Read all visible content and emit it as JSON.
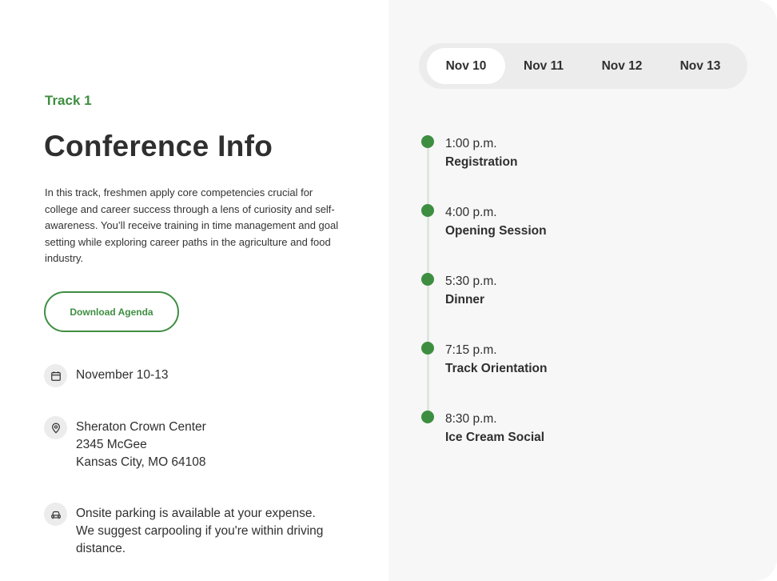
{
  "info": {
    "track_label": "Track 1",
    "title": "Conference Info",
    "description": "In this track, freshmen apply core competencies crucial for college and career success through a lens of curiosity and self-awareness. You’ll receive training in time management and goal setting while exploring career paths in the agriculture and food industry.",
    "download_label": "Download Agenda",
    "dates": "November 10-13",
    "venue": {
      "name": "Sheraton Crown Center",
      "street": "2345 McGee",
      "city": "Kansas City, MO 64108"
    },
    "parking": {
      "line1": "Onsite parking is available at your expense.",
      "line2": "We suggest carpooling if you're within driving",
      "line3": "distance."
    },
    "icons": {
      "date": "calendar-icon",
      "venue": "location-pin-icon",
      "parking": "car-icon"
    }
  },
  "schedule": {
    "tabs": [
      {
        "label": "Nov 10",
        "active": true
      },
      {
        "label": "Nov 11",
        "active": false
      },
      {
        "label": "Nov 12",
        "active": false
      },
      {
        "label": "Nov 13",
        "active": false
      }
    ],
    "events": [
      {
        "time": "1:00 p.m.",
        "name": "Registration"
      },
      {
        "time": "4:00 p.m.",
        "name": "Opening Session"
      },
      {
        "time": "5:30 p.m.",
        "name": "Dinner"
      },
      {
        "time": "7:15 p.m.",
        "name": "Track Orientation"
      },
      {
        "time": "8:30 p.m.",
        "name": "Ice Cream Social"
      }
    ]
  },
  "colors": {
    "accent": "#3e8e41",
    "panel_bg": "#f7f7f7",
    "tabs_bg": "#ececec",
    "text": "#2f2f2f"
  }
}
